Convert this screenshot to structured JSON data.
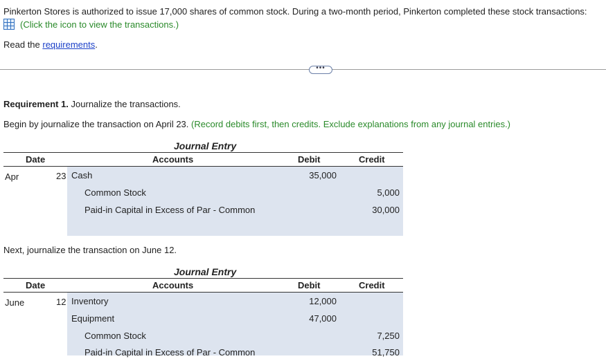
{
  "intro": {
    "text": "Pinkerton Stores is authorized to issue 17,000 shares of common stock. During a two-month period, Pinkerton completed these stock transactions:",
    "click_text": "(Click the icon to view the transactions.)",
    "read_prefix": "Read the ",
    "requirements_link": "requirements",
    "read_suffix": "."
  },
  "divider": {
    "button_text": "•••"
  },
  "requirement": {
    "label": "Requirement 1.",
    "text": " Journalize the transactions.",
    "begin_text": "Begin by journalize the transaction on April 23.",
    "begin_note": "(Record debits first, then credits. Exclude explanations from any journal entries.)",
    "next_text": "Next, journalize the transaction on June 12."
  },
  "journal1": {
    "title": "Journal Entry",
    "headers": {
      "date": "Date",
      "accounts": "Accounts",
      "debit": "Debit",
      "credit": "Credit"
    },
    "month": "Apr",
    "day": "23",
    "rows": [
      {
        "account": "Cash",
        "debit": "35,000",
        "credit": ""
      },
      {
        "account": "Common Stock",
        "debit": "",
        "credit": "5,000"
      },
      {
        "account": "Paid-in Capital in Excess of Par - Common",
        "debit": "",
        "credit": "30,000"
      }
    ]
  },
  "journal2": {
    "title": "Journal Entry",
    "headers": {
      "date": "Date",
      "accounts": "Accounts",
      "debit": "Debit",
      "credit": "Credit"
    },
    "month": "June",
    "day": "12",
    "rows": [
      {
        "account": "Inventory",
        "debit": "12,000",
        "credit": ""
      },
      {
        "account": "Equipment",
        "debit": "47,000",
        "credit": ""
      },
      {
        "account": "Common Stock",
        "debit": "",
        "credit": "7,250"
      },
      {
        "account": "Paid-in Capital in Excess of Par - Common",
        "debit": "",
        "credit": "51,750"
      }
    ]
  },
  "colors": {
    "accent_green": "#2a8a2a",
    "link_blue": "#1a3fc8",
    "cell_bg": "#dde4ef"
  }
}
